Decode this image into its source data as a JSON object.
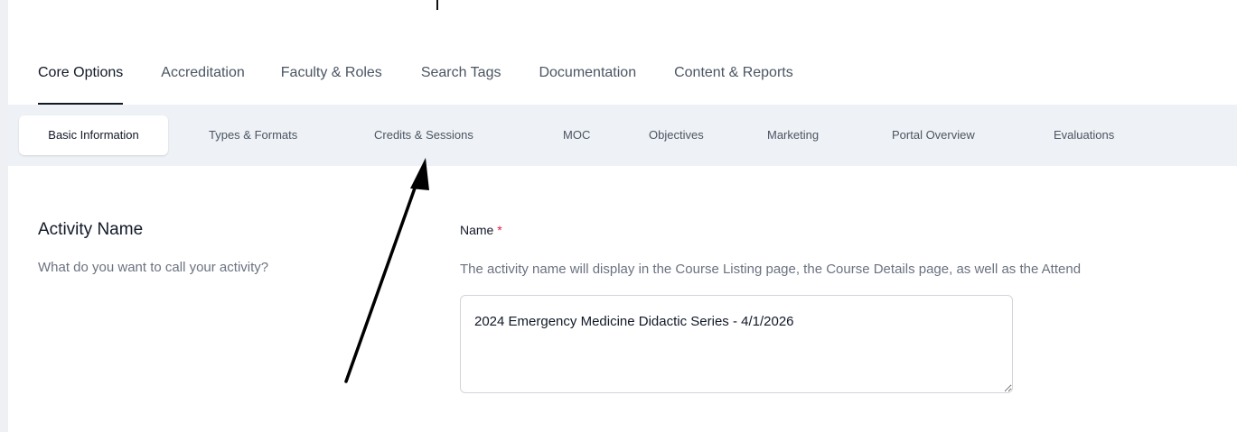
{
  "main_tabs": [
    {
      "label": "Core Options",
      "active": true
    },
    {
      "label": "Accreditation",
      "active": false
    },
    {
      "label": "Faculty & Roles",
      "active": false
    },
    {
      "label": "Search Tags",
      "active": false
    },
    {
      "label": "Documentation",
      "active": false
    },
    {
      "label": "Content & Reports",
      "active": false
    }
  ],
  "sub_tabs": [
    {
      "label": "Basic Information",
      "active": true
    },
    {
      "label": "Types & Formats",
      "active": false
    },
    {
      "label": "Credits & Sessions",
      "active": false
    },
    {
      "label": "MOC",
      "active": false
    },
    {
      "label": "Objectives",
      "active": false
    },
    {
      "label": "Marketing",
      "active": false
    },
    {
      "label": "Portal Overview",
      "active": false
    },
    {
      "label": "Evaluations",
      "active": false
    }
  ],
  "section": {
    "title": "Activity Name",
    "description": "What do you want to call your activity?"
  },
  "field": {
    "label": "Name",
    "required_marker": "*",
    "help": "The activity name will display in the Course Listing page, the Course Details page, as well as the Attend",
    "value": "2024 Emergency Medicine Didactic Series - 4/1/2026"
  },
  "colors": {
    "subnav_background": "#eef1f5",
    "required": "#e11d48",
    "annotation_arrow": "#000000"
  },
  "icons": {
    "annotation": "arrow-up-annotation-icon",
    "resize": "resize-handle-icon"
  }
}
